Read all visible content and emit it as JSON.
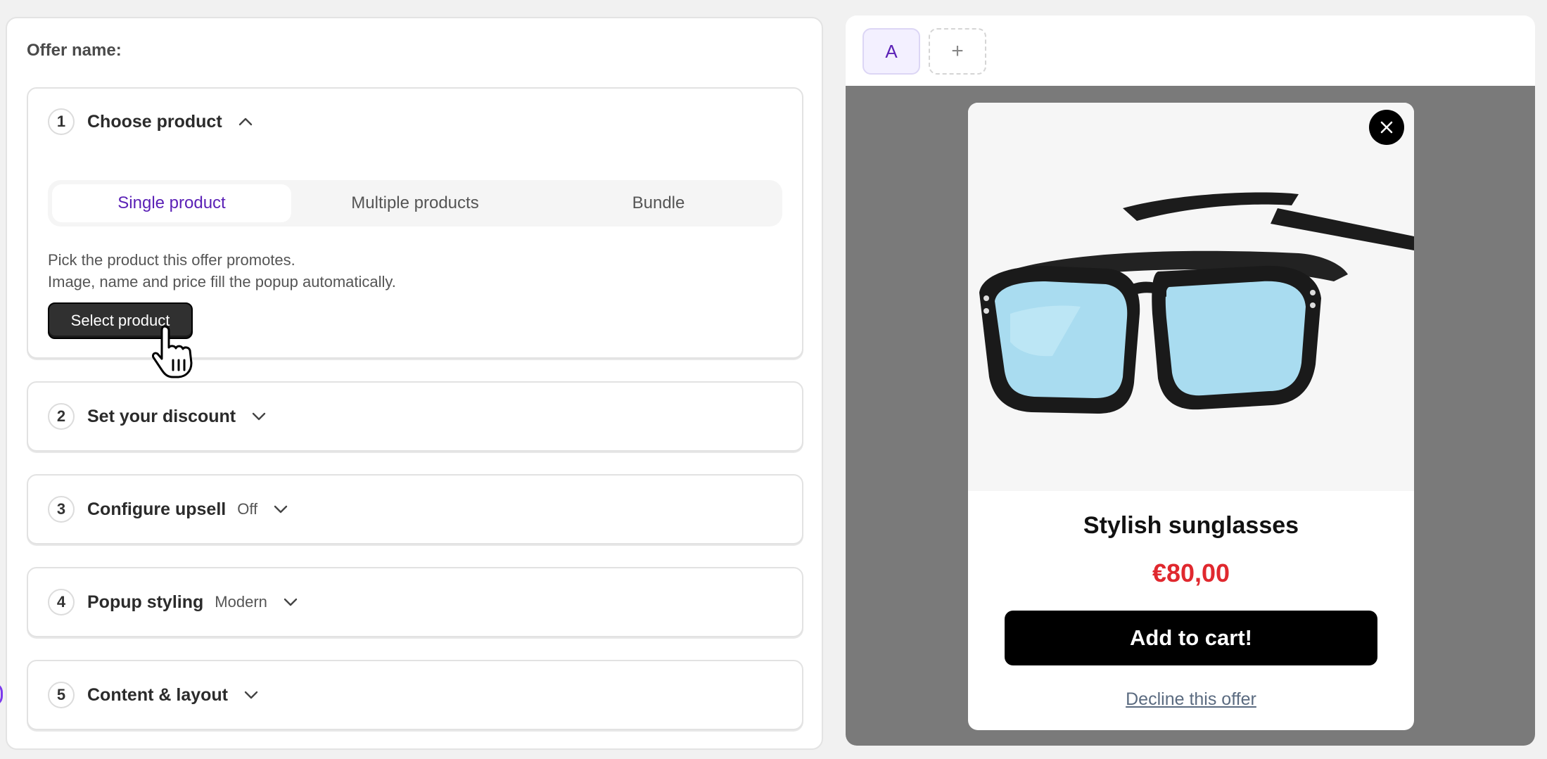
{
  "offer": {
    "name_label": "Offer name:"
  },
  "sections": [
    {
      "number": "1",
      "title": "Choose product",
      "status": "",
      "expanded": true
    },
    {
      "number": "2",
      "title": "Set your discount",
      "status": ""
    },
    {
      "number": "3",
      "title": "Configure upsell",
      "status": "Off"
    },
    {
      "number": "4",
      "title": "Popup styling",
      "status": "Modern"
    },
    {
      "number": "5",
      "title": "Content & layout",
      "status": ""
    }
  ],
  "product_tabs": {
    "items": [
      {
        "label": "Single product",
        "active": true
      },
      {
        "label": "Multiple products",
        "active": false
      },
      {
        "label": "Bundle",
        "active": false
      }
    ]
  },
  "choose_product": {
    "description_line1": "Pick the product this offer promotes.",
    "description_line2": "Image, name and price fill the popup automatically.",
    "select_button": "Select product"
  },
  "variants": {
    "items": [
      {
        "label": "A",
        "active": true
      }
    ],
    "add_label": "+"
  },
  "popup": {
    "product_name": "Stylish sunglasses",
    "price": "€80,00",
    "cart_button": "Add to cart!",
    "decline_link": "Decline this offer"
  },
  "colors": {
    "accent": "#5b21b6",
    "price": "#e0282e",
    "preview_bg": "#7a7a7a",
    "button": "#000000"
  }
}
